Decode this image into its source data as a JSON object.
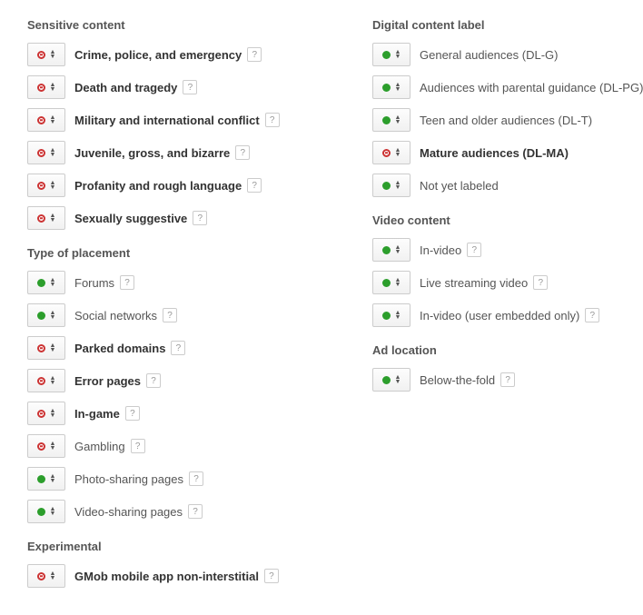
{
  "sections": [
    {
      "col": 0,
      "title": "Sensitive content",
      "items": [
        {
          "status": "red",
          "label": "Crime, police, and emergency",
          "bold": true,
          "help": true
        },
        {
          "status": "red",
          "label": "Death and tragedy",
          "bold": true,
          "help": true
        },
        {
          "status": "red",
          "label": "Military and international conflict",
          "bold": true,
          "help": true
        },
        {
          "status": "red",
          "label": "Juvenile, gross, and bizarre",
          "bold": true,
          "help": true
        },
        {
          "status": "red",
          "label": "Profanity and rough language",
          "bold": true,
          "help": true
        },
        {
          "status": "red",
          "label": "Sexually suggestive",
          "bold": true,
          "help": true
        }
      ]
    },
    {
      "col": 0,
      "title": "Type of placement",
      "items": [
        {
          "status": "green",
          "label": "Forums",
          "bold": false,
          "help": true
        },
        {
          "status": "green",
          "label": "Social networks",
          "bold": false,
          "help": true
        },
        {
          "status": "red",
          "label": "Parked domains",
          "bold": true,
          "help": true
        },
        {
          "status": "red",
          "label": "Error pages",
          "bold": true,
          "help": true
        },
        {
          "status": "red",
          "label": "In-game",
          "bold": true,
          "help": true
        },
        {
          "status": "red",
          "label": "Gambling",
          "bold": false,
          "help": true
        },
        {
          "status": "green",
          "label": "Photo-sharing pages",
          "bold": false,
          "help": true
        },
        {
          "status": "green",
          "label": "Video-sharing pages",
          "bold": false,
          "help": true
        }
      ]
    },
    {
      "col": 0,
      "title": "Experimental",
      "items": [
        {
          "status": "red",
          "label": "GMob mobile app non-interstitial",
          "bold": true,
          "help": true
        }
      ]
    },
    {
      "col": 1,
      "title": "Digital content label",
      "items": [
        {
          "status": "green",
          "label": "General audiences (DL-G)",
          "bold": false,
          "help": false
        },
        {
          "status": "green",
          "label": "Audiences with parental guidance (DL-PG)",
          "bold": false,
          "help": false
        },
        {
          "status": "green",
          "label": "Teen and older audiences (DL-T)",
          "bold": false,
          "help": false
        },
        {
          "status": "red",
          "label": "Mature audiences (DL-MA)",
          "bold": true,
          "help": false
        },
        {
          "status": "green",
          "label": "Not yet labeled",
          "bold": false,
          "help": false
        }
      ]
    },
    {
      "col": 1,
      "title": "Video content",
      "items": [
        {
          "status": "green",
          "label": "In-video",
          "bold": false,
          "help": true
        },
        {
          "status": "green",
          "label": "Live streaming video",
          "bold": false,
          "help": true
        },
        {
          "status": "green",
          "label": "In-video (user embedded only)",
          "bold": false,
          "help": true
        }
      ]
    },
    {
      "col": 1,
      "title": "Ad location",
      "items": [
        {
          "status": "green",
          "label": "Below-the-fold",
          "bold": false,
          "help": true
        }
      ]
    }
  ]
}
